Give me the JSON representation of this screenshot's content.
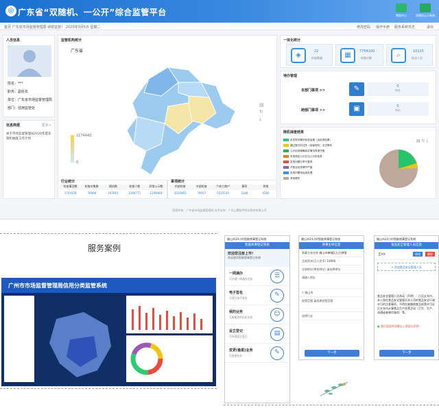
{
  "header": {
    "title": "广东省“双随机、一公开”综合监管平台",
    "buttons": [
      "数据中心",
      "双随机公示系统"
    ]
  },
  "crumb": {
    "text": "首页 广东省市场监督管理局  绩效监管）  2020年3月5日 星期二",
    "links": [
      "修改密码",
      "操作手册",
      "服务系统日志",
      "退出"
    ]
  },
  "person": {
    "title": "人员信息",
    "fields": [
      {
        "k": "姓名：",
        "v": "***"
      },
      {
        "k": "职务：",
        "v": "副处长"
      },
      {
        "k": "单位：",
        "v": "广东省市场监督管理局"
      },
      {
        "k": "部门：",
        "v": "信用监管处"
      }
    ]
  },
  "notice": {
    "title": "信息简报",
    "more": "更多>",
    "items": [
      "关于市场监督管理局2020年度双随机抽查工作计划"
    ]
  },
  "map": {
    "title": "监管机构统计",
    "region": "广东省",
    "legend_max": "1174440",
    "legend_min": "0"
  },
  "summary": {
    "title": "一体化统计",
    "stats": [
      {
        "num": "22",
        "lbl": "检查数量"
      },
      {
        "num": "7754100",
        "lbl": "检查对象"
      },
      {
        "num": "10115",
        "lbl": "执法人员"
      }
    ]
  },
  "todo": {
    "title": "待办管理",
    "items": [
      {
        "lbl": "本部门事项 >>",
        "num": "0",
        "sub": "待办"
      },
      {
        "lbl": "跨部门事项 >>",
        "num": "0",
        "sub": "待办"
      }
    ]
  },
  "result": {
    "title": "随机抽查结果",
    "items": [
      {
        "t": "未发现问题的检查结果（含检查结果）",
        "c": "#2ecc71"
      },
      {
        "t": "通过登记的住所（经营场所）无法联系",
        "c": "#f1c40f"
      },
      {
        "t": "公示信息隐瞒真实情况弄虚作假",
        "c": "#27ae60"
      },
      {
        "t": "未按规定公示应当公示的信息",
        "c": "#e67e22"
      },
      {
        "t": "发现问题已责令整改",
        "c": "#e74c3c"
      },
      {
        "t": "不配合检查情节严重",
        "c": "#9b59b6"
      },
      {
        "t": "发现问题待后续处理",
        "c": "#3498db"
      },
      {
        "t": "其他情形",
        "c": "#bfa89a"
      }
    ]
  },
  "table1": {
    "title": "行业统计",
    "headers": [
      "检查事项数",
      "检查对象数",
      "随机数",
      "检查人数",
      "异常公示数"
    ],
    "values": [
      "1744578",
      "76988",
      "167661",
      "1269771",
      "1294983"
    ]
  },
  "table2": {
    "title": "事项统计",
    "headers": [
      "内部检查",
      "外部检查",
      "个体工商户",
      "事项",
      "其他"
    ],
    "values": [
      "2016983",
      "79057",
      "0525520",
      "3348",
      "4780"
    ]
  },
  "footer": "版权所有：广东省市场监督管理局  技术支持：广东山鹰软件科技股份有限公司",
  "case": {
    "title": "服务案例"
  },
  "mini": {
    "title": "广州市市场监督管理局信用分类监管系统"
  },
  "phone1": {
    "head": "佛山市24小时智能商事登记系统",
    "bar": "智能商事登记系统",
    "banner_title": "欢迎您注册上市!",
    "banner_sub": "欢迎使用智能商事登记系统",
    "menu": [
      {
        "t": "一网通办",
        "s": "可办理一网通办业务"
      },
      {
        "t": "电子签名",
        "s": "可进行电子签名"
      },
      {
        "t": "我的业务",
        "s": "可查看我的历史业务"
      },
      {
        "t": "设立登记",
        "s": "可办理设立登记"
      },
      {
        "t": "变更(备案)业务",
        "s": "可变更业务"
      }
    ]
  },
  "phone2": {
    "head": "佛山市24小时智能商事登记系统",
    "bar": "商事主体信息",
    "rows": [
      {
        "k": "商事主体名称",
        "v": "佛山市禅城区九分钟哦"
      },
      {
        "k": "注册资本(万人民币)",
        "v": "10000"
      },
      {
        "k": "注册地址(审批地址)",
        "v": "请选择地址"
      },
      {
        "k": "请输入地址",
        "v": ""
      },
      {
        "k": "经营场所",
        "v": "佛山市"
      },
      {
        "k": "经营范围",
        "v": "请选择经营范围"
      },
      {
        "k": "选择行业",
        "v": ""
      }
    ],
    "btn": "下一步"
  },
  "phone3": {
    "head": "佛山市24小时智能商事登记系统",
    "bar": "食品安全管理人员信息",
    "name": "王XX",
    "edit": "修改",
    "del": "删除",
    "add": "+ 添加食品安全管理人员",
    "text": "食品安全管理人员承诺（声明）：日至五年内，本人保任食品安全管理员本公司的食品安全行政许可的注意事项，不得在被撤销食品经营许可证后五年内从事食品生产经营活动（卫生、生产、流通或者餐饮服务）等。",
    "agree": "我已阅读并同意以上承诺与声明",
    "btn": "下一步"
  }
}
